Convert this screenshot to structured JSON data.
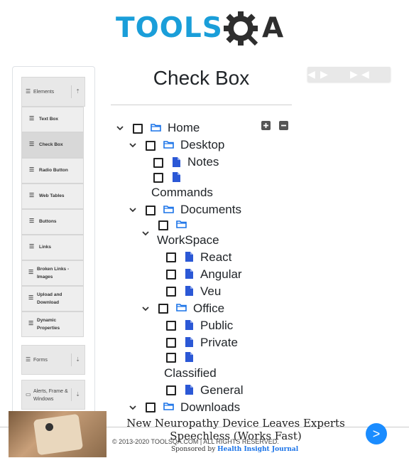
{
  "header": {
    "logo_text": "TOOLS",
    "logo_a": "A",
    "logo_alt": "TOOLSQA"
  },
  "sidebar": {
    "groups": [
      {
        "label": "Elements",
        "arrow": "⇡"
      },
      {
        "label": "Forms",
        "arrow": "⇣"
      },
      {
        "label": "Alerts, Frame & Windows",
        "arrow": "⇣"
      }
    ],
    "items": [
      {
        "label": "Text Box"
      },
      {
        "label": "Check Box"
      },
      {
        "label": "Radio Button"
      },
      {
        "label": "Web Tables"
      },
      {
        "label": "Buttons"
      },
      {
        "label": "Links"
      },
      {
        "label": "Broken Links - Images"
      },
      {
        "label": "Upload and Download"
      },
      {
        "label": "Dynamic Properties"
      }
    ]
  },
  "main": {
    "title": "Check Box",
    "expand_all": "+",
    "collapse_all": "−",
    "tree": {
      "home": "Home",
      "desktop": "Desktop",
      "notes": "Notes",
      "commands": "Commands",
      "documents": "Documents",
      "workspace": "WorkSpace",
      "react": "React",
      "angular": "Angular",
      "veu": "Veu",
      "office": "Office",
      "public": "Public",
      "private": "Private",
      "classified": "Classified",
      "general": "General",
      "downloads": "Downloads"
    }
  },
  "footer": {
    "text": "© 2013-2020 TOOLSQA.COM | ALL RIGHTS RESERVED."
  },
  "ad": {
    "headline": "New Neuropathy Device Leaves Experts Speechless (Works Fast)",
    "sponsor_prefix": "Sponsored by ",
    "sponsor_name": "Health Insight Journal",
    "go": ">"
  },
  "colors": {
    "brand_blue": "#1a9ed9",
    "folder_blue": "#1a73e8",
    "file_blue": "#2b58d6",
    "ad_button": "#1a8cff"
  }
}
